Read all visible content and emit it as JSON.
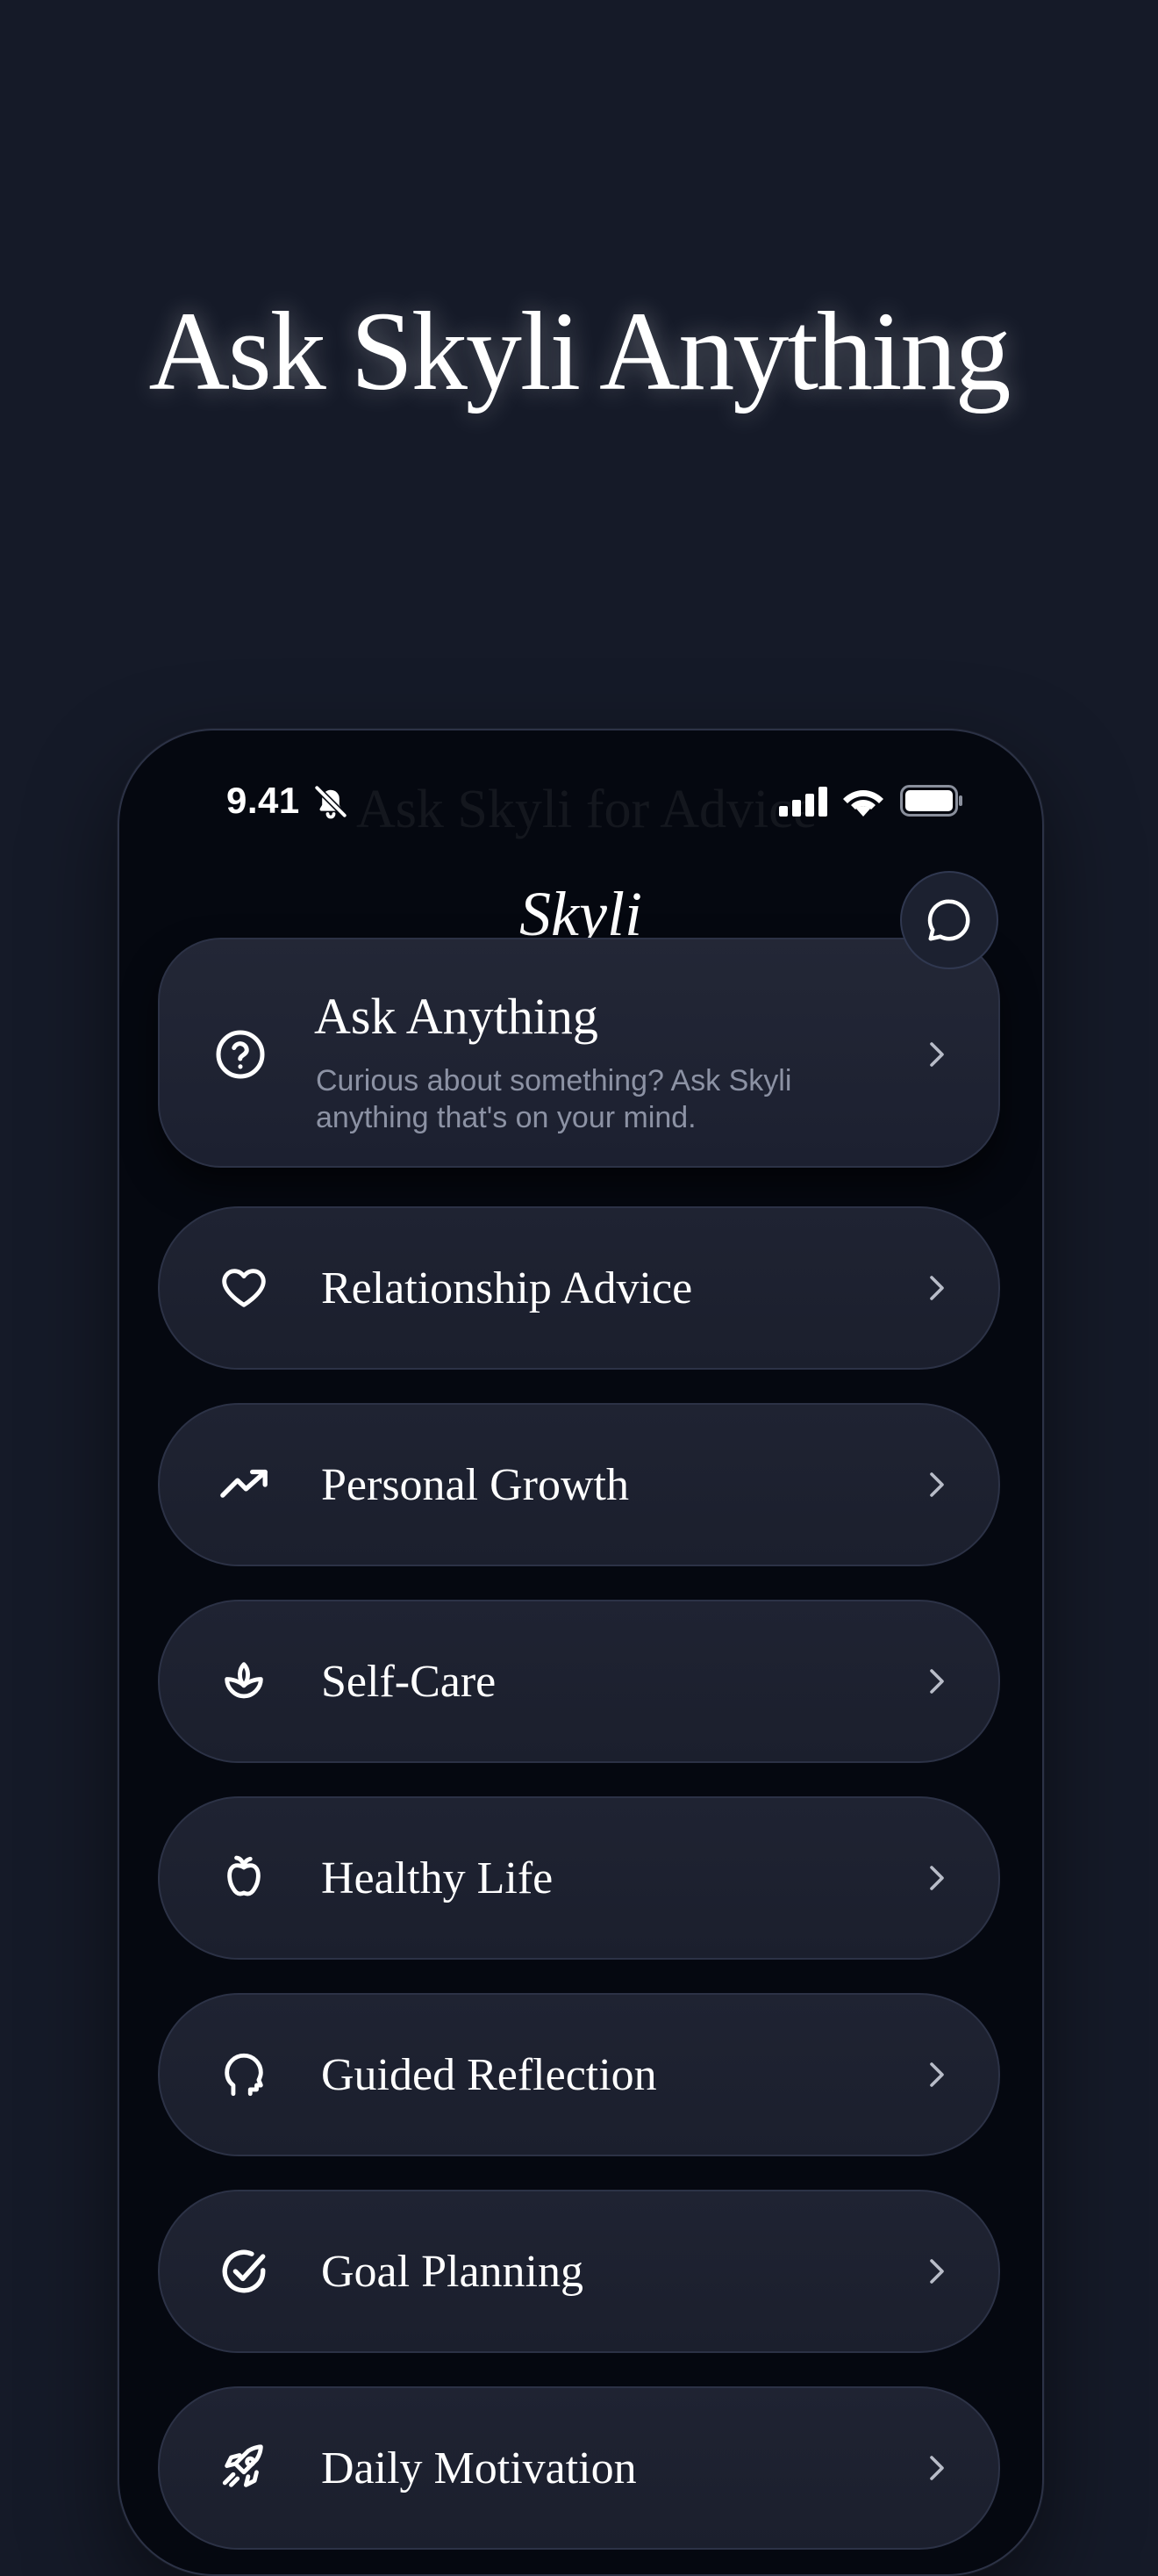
{
  "hero": {
    "title": "Ask Skyli Anything"
  },
  "status_bar": {
    "time": "9.41",
    "ghost_title": "Ask Skyli for Advice"
  },
  "app": {
    "title": "Skyli",
    "chat_icon": "chat-bubble-icon"
  },
  "featured": {
    "title": "Ask Anything",
    "description": "Curious about something? Ask Skyli anything that's on your mind.",
    "icon": "question-circle-icon"
  },
  "menu": {
    "items": [
      {
        "label": "Relationship Advice",
        "icon": "heart-icon"
      },
      {
        "label": "Personal Growth",
        "icon": "trend-up-icon"
      },
      {
        "label": "Self-Care",
        "icon": "lotus-icon"
      },
      {
        "label": "Healthy Life",
        "icon": "apple-icon"
      },
      {
        "label": "Guided Reflection",
        "icon": "head-icon"
      },
      {
        "label": "Goal Planning",
        "icon": "check-circle-icon"
      },
      {
        "label": "Daily Motivation",
        "icon": "rocket-icon"
      }
    ]
  },
  "colors": {
    "background": "#151a28",
    "phone": "#050810",
    "card": "#1e2231",
    "card_border": "#2c3246",
    "text": "#ffffff",
    "muted": "#8c92a4"
  }
}
